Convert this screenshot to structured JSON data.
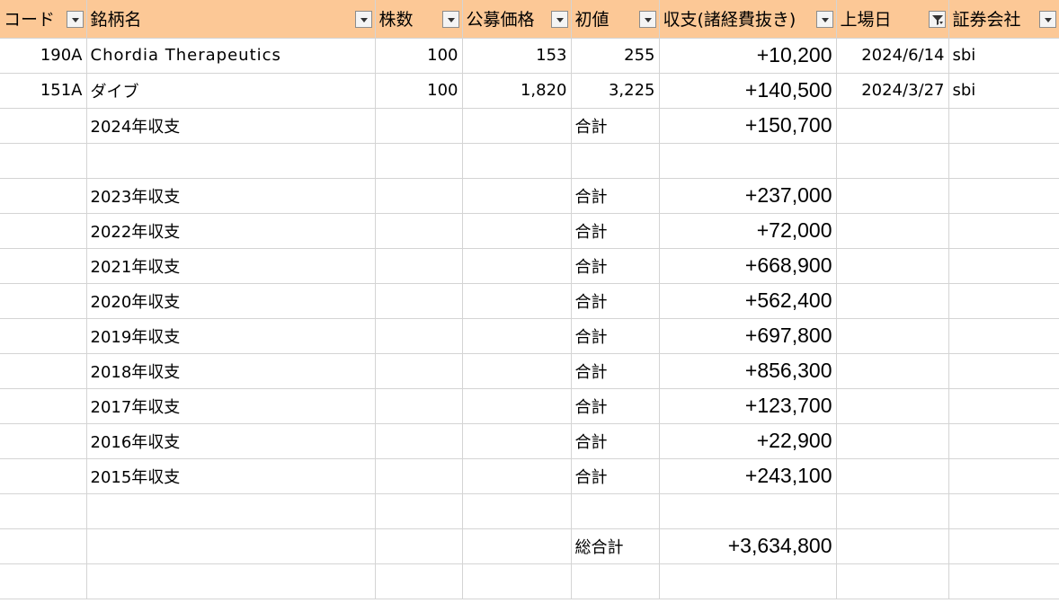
{
  "columns": [
    "コード",
    "銘柄名",
    "株数",
    "公募価格",
    "初値",
    "収支(諸経費抜き)",
    "上場日",
    "証券会社"
  ],
  "filter_active_column": "上場日",
  "stocks": [
    {
      "code": "190A",
      "name": "Chordia Therapeutics",
      "shares": "100",
      "offer_price": "153",
      "initial_price": "255",
      "pnl": "+10,200",
      "listing_date": "2024/6/14",
      "broker": "sbi"
    },
    {
      "code": "151A",
      "name": "ダイブ",
      "shares": "100",
      "offer_price": "1,820",
      "initial_price": "3,225",
      "pnl": "+140,500",
      "listing_date": "2024/3/27",
      "broker": "sbi"
    }
  ],
  "total_label": "合計",
  "year_totals": [
    {
      "label": "2024年収支",
      "value": "+150,700"
    },
    {
      "label": "2023年収支",
      "value": "+237,000"
    },
    {
      "label": "2022年収支",
      "value": "+72,000"
    },
    {
      "label": "2021年収支",
      "value": "+668,900"
    },
    {
      "label": "2020年収支",
      "value": "+562,400"
    },
    {
      "label": "2019年収支",
      "value": "+697,800"
    },
    {
      "label": "2018年収支",
      "value": "+856,300"
    },
    {
      "label": "2017年収支",
      "value": "+123,700"
    },
    {
      "label": "2016年収支",
      "value": "+22,900"
    },
    {
      "label": "2015年収支",
      "value": "+243,100"
    }
  ],
  "grand_total": {
    "label": "総合計",
    "value": "+3,634,800"
  },
  "colors": {
    "header_bg": "#fcc896",
    "gridline": "#d4d4d4"
  }
}
